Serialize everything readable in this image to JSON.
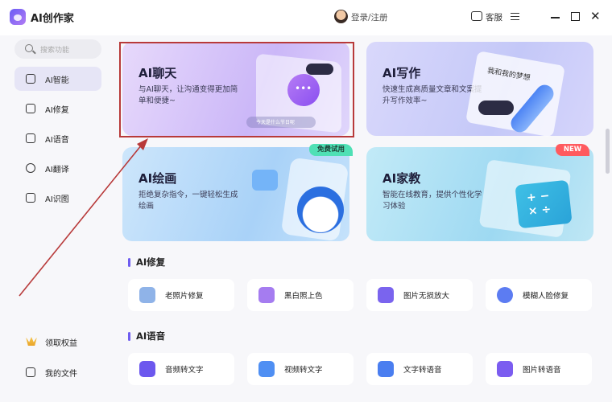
{
  "app": {
    "title": "AI创作家"
  },
  "header": {
    "login_text": "登录/注册",
    "service_label": "客服"
  },
  "sidebar": {
    "search_placeholder": "搜索功能",
    "items": [
      {
        "label": "AI智能",
        "icon": "ai-chip-icon",
        "active": true
      },
      {
        "label": "AI修复",
        "icon": "image-repair-icon"
      },
      {
        "label": "AI语音",
        "icon": "audio-wave-icon"
      },
      {
        "label": "AI翻译",
        "icon": "translate-icon"
      },
      {
        "label": "AI识图",
        "icon": "image-recognize-icon"
      }
    ],
    "bottom_items": [
      {
        "label": "领取权益",
        "icon": "vip-crown-icon"
      },
      {
        "label": "我的文件",
        "icon": "file-icon"
      }
    ]
  },
  "cards": {
    "chat": {
      "title": "AI聊天",
      "desc": "与AI聊天，让沟通变得更加简单和便捷~",
      "tag": "今天是什么节日呢"
    },
    "write": {
      "title": "AI写作",
      "desc": "快速生成高质量文章和文案提升写作效率~",
      "book_text": "我和我的梦想"
    },
    "draw": {
      "title": "AI绘画",
      "desc": "拒绝复杂指令，一键轻松生成绘画",
      "badge": "免费试用"
    },
    "tutor": {
      "title": "AI家教",
      "desc": "智能在线教育，提供个性化学习体验",
      "badge": "NEW",
      "math": "+ −\n× ÷"
    }
  },
  "sections": {
    "repair": {
      "title": "AI修复",
      "tools": [
        {
          "label": "老照片修复",
          "color": "#8fb3e8"
        },
        {
          "label": "黑白照上色",
          "color": "#a57cf0"
        },
        {
          "label": "图片无损放大",
          "color": "#7a64ee"
        },
        {
          "label": "模糊人脸修复",
          "color": "#5c7cf2"
        }
      ]
    },
    "voice": {
      "title": "AI语音",
      "tools": [
        {
          "label": "音频转文字",
          "color": "#6c58ee"
        },
        {
          "label": "视频转文字",
          "color": "#4f8ff3"
        },
        {
          "label": "文字转语音",
          "color": "#4a7ef0"
        },
        {
          "label": "图片转语音",
          "color": "#7b5cf0"
        }
      ]
    }
  },
  "colors": {
    "accent": "#6e5cf0",
    "highlight": "#b83a3a"
  }
}
